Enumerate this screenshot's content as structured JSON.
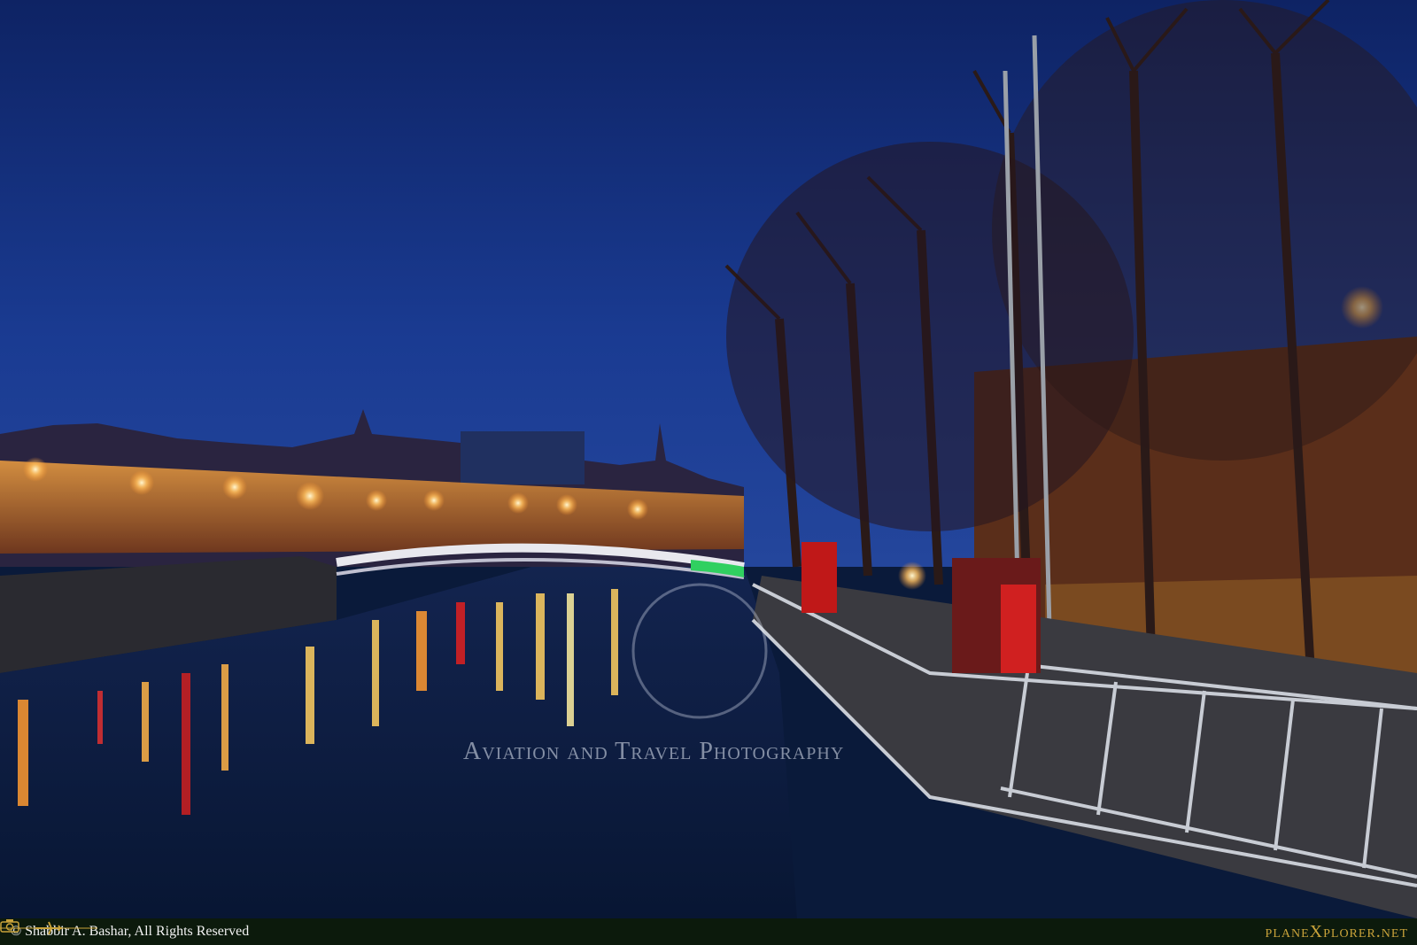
{
  "photo": {
    "watermark_text": "Aviation and Travel Photography",
    "copyright": "© Shabbir A. Bashar, All Rights Reserved",
    "brand": "planeXplorer.net",
    "colors": {
      "sky": "#0f2a70",
      "water": "#0b1a40",
      "street_light": "#ffb347",
      "footer": "#0c1a0c",
      "brand_gold": "#c8a23a"
    }
  }
}
